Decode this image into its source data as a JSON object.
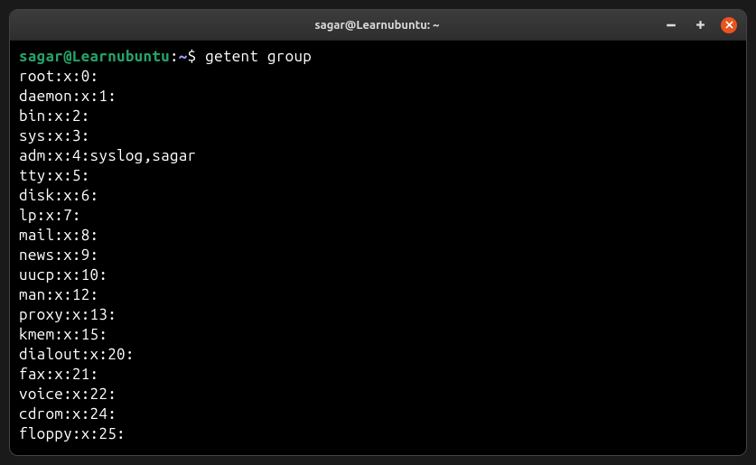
{
  "window": {
    "title": "sagar@Learnubuntu: ~"
  },
  "prompt": {
    "userhost": "sagar@Learnubuntu",
    "path": "~",
    "symbol": "$",
    "command": "getent group"
  },
  "output": [
    "root:x:0:",
    "daemon:x:1:",
    "bin:x:2:",
    "sys:x:3:",
    "adm:x:4:syslog,sagar",
    "tty:x:5:",
    "disk:x:6:",
    "lp:x:7:",
    "mail:x:8:",
    "news:x:9:",
    "uucp:x:10:",
    "man:x:12:",
    "proxy:x:13:",
    "kmem:x:15:",
    "dialout:x:20:",
    "fax:x:21:",
    "voice:x:22:",
    "cdrom:x:24:",
    "floppy:x:25:"
  ]
}
